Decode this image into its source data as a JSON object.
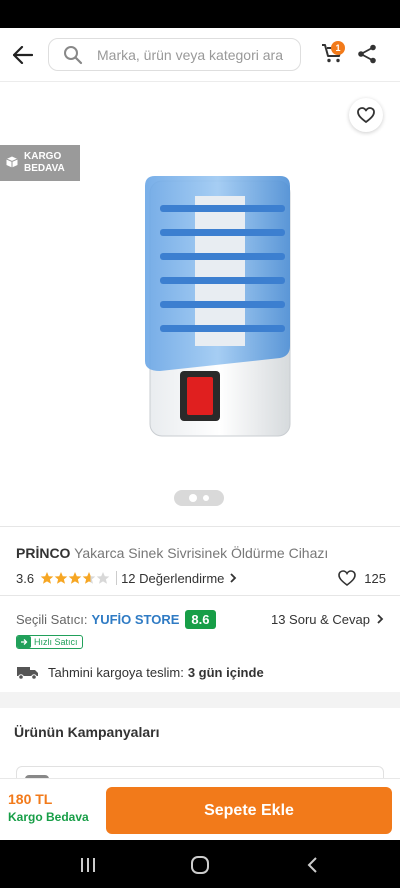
{
  "header": {
    "search_placeholder": "Marka, ürün veya kategori ara",
    "cart_count": "1"
  },
  "gallery": {
    "badge_line1": "KARGO",
    "badge_line2": "BEDAVA",
    "image_count": 2,
    "active_image": 1
  },
  "product": {
    "brand": "PRİNCO",
    "name": "Yakarca Sinek Sivrisinek Öldürme Cihazı",
    "rating": "3.6",
    "rating_value": 3.6,
    "rating_max": 5,
    "reviews_label": "12 Değerlendirme",
    "favorite_count": "125"
  },
  "seller": {
    "label": "Seçili Satıcı:",
    "name": "YUFİO STORE",
    "score": "8.6",
    "fast_label": "Hızlı Satıcı",
    "qa_label": "13 Soru & Cevap"
  },
  "delivery": {
    "label": "Tahmini kargoya teslim:",
    "days": "3 gün içinde"
  },
  "campaigns": {
    "title": "Ürünün Kampanyaları"
  },
  "bottom": {
    "price": "180 TL",
    "shipping": "Kargo Bedava",
    "add_button": "Sepete Ekle"
  },
  "colors": {
    "accent": "#f27a1a",
    "green": "#179e47",
    "seller_blue": "#2f7bc4",
    "star": "#f6a623"
  }
}
